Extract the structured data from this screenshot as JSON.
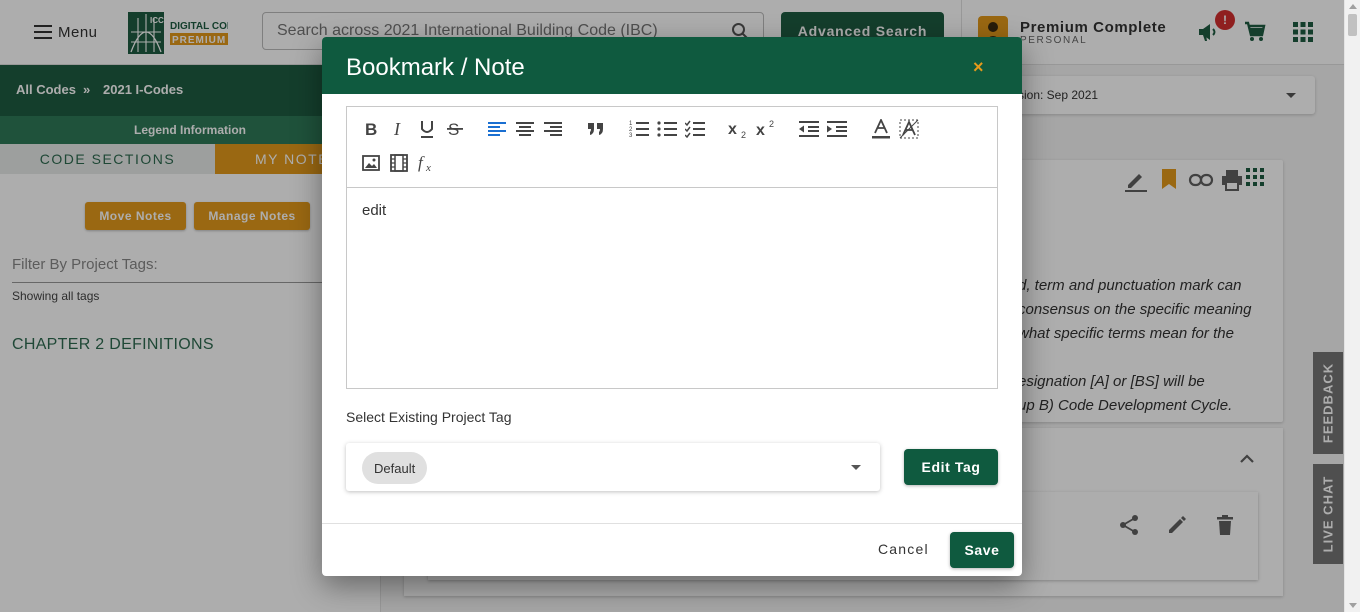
{
  "header": {
    "menu_label": "Menu",
    "logo_badge": "ICC",
    "logo_line1": "DIGITAL CODES",
    "logo_line2": "PREMIUM",
    "search_placeholder": "Search across 2021 International Building Code (IBC)",
    "advanced_search_label": "Advanced Search",
    "account_name": "Premium Complete",
    "account_type": "PERSONAL",
    "alert_count": "!",
    "icons": [
      "menu-icon",
      "search-icon",
      "account-icon",
      "megaphone-icon",
      "cart-icon",
      "apps-grid-icon"
    ]
  },
  "sidebar": {
    "breadcrumb": [
      "All Codes",
      "»",
      "2021 I-Codes"
    ],
    "legend_label": "Legend Information",
    "tabs": [
      {
        "label": "CODE SECTIONS"
      },
      {
        "label": "MY NOTES"
      }
    ],
    "move_notes_label": "Move Notes",
    "manage_notes_label": "Manage Notes",
    "filter_label": "Filter By Project Tags:",
    "showing_tags": "Showing all tags",
    "chapter_link": "CHAPTER 2 DEFINITIONS"
  },
  "content": {
    "version_text": "sion: Sep 2021",
    "definition_lines": [
      "d, term and punctuation mark can",
      "consensus on the specific meaning",
      "what specific terms mean for the",
      "",
      "esignation [A] or [BS] will be",
      "up B) Code Development Cycle."
    ],
    "icons": [
      "pencil-icon",
      "bookmark-icon",
      "link-icon",
      "print-icon",
      "apps-grid-icon",
      "chevron-up-icon",
      "share-icon",
      "edit-icon",
      "trash-icon"
    ]
  },
  "side_tabs": {
    "feedback": "FEEDBACK",
    "live_chat": "LIVE CHAT"
  },
  "modal": {
    "title": "Bookmark / Note",
    "close_glyph": "×",
    "editor_content": "edit",
    "toolbar_buttons": [
      "bold",
      "italic",
      "underline",
      "strikethrough",
      "align-left",
      "align-center",
      "align-right",
      "blockquote",
      "ordered-list",
      "bullet-list",
      "checklist",
      "subscript",
      "superscript",
      "outdent",
      "indent",
      "font-color",
      "background-color",
      "image",
      "video",
      "formula"
    ],
    "tag_label": "Select Existing Project Tag",
    "selected_tag": "Default",
    "edit_tag_label": "Edit Tag",
    "cancel_label": "Cancel",
    "save_label": "Save",
    "accent_color": "#0f5a3f",
    "close_color": "#e49a1b",
    "active_align_color": "#1a6fd1"
  }
}
